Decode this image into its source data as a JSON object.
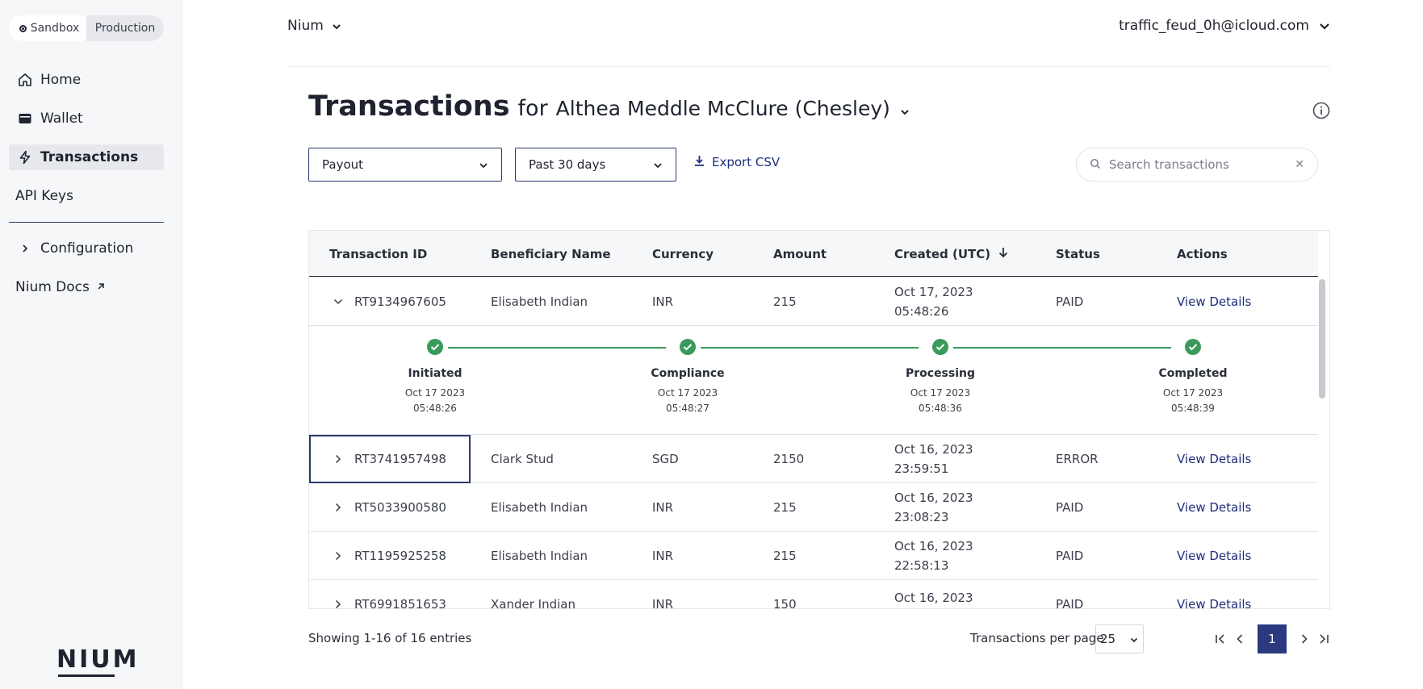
{
  "sidebar": {
    "env": {
      "sandbox": "Sandbox",
      "production": "Production"
    },
    "items": {
      "home": "Home",
      "wallet": "Wallet",
      "transactions": "Transactions",
      "api_keys": "API Keys",
      "configuration": "Configuration",
      "docs": "Nium Docs"
    },
    "logo": "NIUM"
  },
  "header": {
    "org": "Nium",
    "user": "traffic_feud_0h@icloud.com"
  },
  "title": {
    "main": "Transactions",
    "for": "for",
    "customer": "Althea Meddle McClure (Chesley)"
  },
  "filters": {
    "type": "Payout",
    "range": "Past 30 days",
    "export": "Export CSV",
    "search_placeholder": "Search transactions"
  },
  "table": {
    "headers": {
      "id": "Transaction ID",
      "beneficiary": "Beneficiary Name",
      "currency": "Currency",
      "amount": "Amount",
      "created": "Created (UTC)",
      "status": "Status",
      "actions": "Actions"
    },
    "rows": [
      {
        "id": "RT9134967605",
        "beneficiary": "Elisabeth Indian",
        "currency": "INR",
        "amount": "215",
        "date": "Oct 17, 2023",
        "time": "05:48:26",
        "status": "PAID",
        "action": "View Details"
      },
      {
        "id": "RT3741957498",
        "beneficiary": "Clark Stud",
        "currency": "SGD",
        "amount": "2150",
        "date": "Oct 16, 2023",
        "time": "23:59:51",
        "status": "ERROR",
        "action": "View Details"
      },
      {
        "id": "RT5033900580",
        "beneficiary": "Elisabeth Indian",
        "currency": "INR",
        "amount": "215",
        "date": "Oct 16, 2023",
        "time": "23:08:23",
        "status": "PAID",
        "action": "View Details"
      },
      {
        "id": "RT1195925258",
        "beneficiary": "Elisabeth Indian",
        "currency": "INR",
        "amount": "215",
        "date": "Oct 16, 2023",
        "time": "22:58:13",
        "status": "PAID",
        "action": "View Details"
      },
      {
        "id": "RT6991851653",
        "beneficiary": "Xander Indian",
        "currency": "INR",
        "amount": "150",
        "date": "Oct 16, 2023",
        "time": "",
        "status": "PAID",
        "action": "View Details"
      }
    ],
    "timeline": [
      {
        "label": "Initiated",
        "date": "Oct 17 2023",
        "time": "05:48:26"
      },
      {
        "label": "Compliance",
        "date": "Oct 17 2023",
        "time": "05:48:27"
      },
      {
        "label": "Processing",
        "date": "Oct 17 2023",
        "time": "05:48:36"
      },
      {
        "label": "Completed",
        "date": "Oct 17 2023",
        "time": "05:48:39"
      }
    ]
  },
  "footer": {
    "entries": "Showing 1-16 of 16 entries",
    "per_page_label": "Transactions per page",
    "per_page_value": "25",
    "current_page": "1"
  },
  "colors": {
    "accent": "#2b3a7f",
    "success": "#3a9a5c",
    "link": "#1e2f7a"
  }
}
